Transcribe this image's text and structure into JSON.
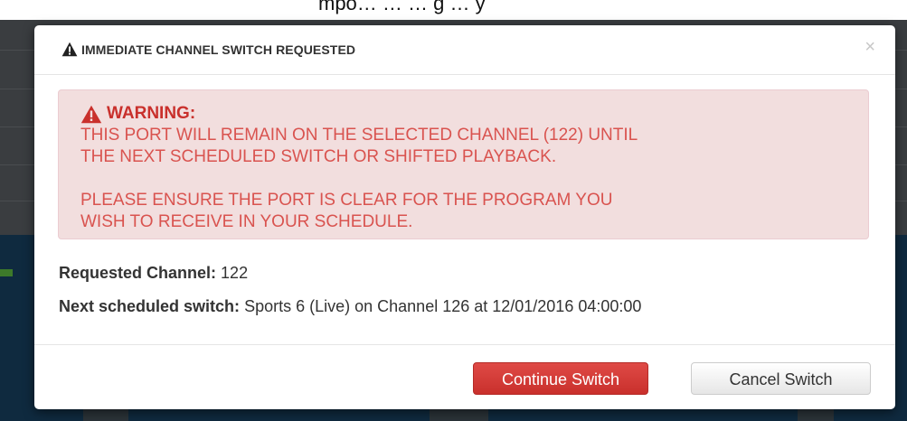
{
  "background": {
    "top_text": "mpo…   …           …   g        …   y",
    "colors": {
      "header": "#3a3d40",
      "body": "#0f2a3f"
    }
  },
  "modal": {
    "title": "IMMEDIATE CHANNEL SWITCH REQUESTED",
    "title_icon": "warning-triangle-icon",
    "close_label": "×",
    "alert": {
      "heading": "WARNING:",
      "icon": "warning-triangle-icon",
      "lines_1": [
        "THIS PORT WILL REMAIN ON THE SELECTED CHANNEL (122) UNTIL",
        "THE NEXT SCHEDULED SWITCH OR SHIFTED PLAYBACK."
      ],
      "lines_2": [
        "PLEASE ENSURE THE PORT IS CLEAR FOR THE PROGRAM YOU",
        "WISH TO RECEIVE IN YOUR SCHEDULE."
      ],
      "colors": {
        "background": "#f2dede",
        "text": "#d9534f"
      }
    },
    "requested_channel": {
      "label": "Requested Channel:",
      "value": "122"
    },
    "next_switch": {
      "label": "Next scheduled switch:",
      "value": "Sports 6 (Live) on Channel 126 at 12/01/2016 04:00:00"
    },
    "buttons": {
      "continue": "Continue Switch",
      "cancel": "Cancel Switch"
    },
    "colors": {
      "danger": "#d9534f"
    }
  }
}
